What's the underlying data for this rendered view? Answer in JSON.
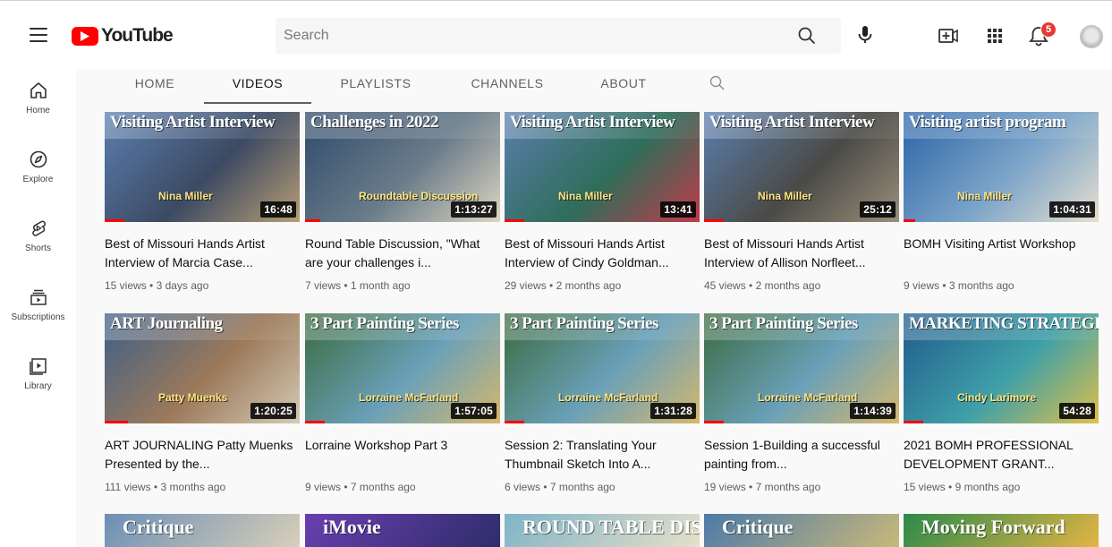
{
  "app": {
    "logo_text": "YouTube",
    "search_placeholder": "Search",
    "notification_count": "5"
  },
  "sidebar": {
    "items": [
      {
        "label": "Home",
        "icon": "home-icon"
      },
      {
        "label": "Explore",
        "icon": "compass-icon"
      },
      {
        "label": "Shorts",
        "icon": "shorts-icon"
      },
      {
        "label": "Subscriptions",
        "icon": "subscriptions-icon"
      },
      {
        "label": "Library",
        "icon": "library-icon"
      }
    ]
  },
  "tabs": [
    {
      "label": "HOME",
      "active": false
    },
    {
      "label": "VIDEOS",
      "active": true
    },
    {
      "label": "PLAYLISTS",
      "active": false
    },
    {
      "label": "CHANNELS",
      "active": false
    },
    {
      "label": "ABOUT",
      "active": false
    }
  ],
  "videos": [
    {
      "title": "Best of Missouri Hands Artist Interview of Marcia Case...",
      "views": "15 views",
      "age": "3 days ago",
      "duration": "16:48",
      "thumb_text": "Visiting Artist Interview",
      "thumb_sub": "Nina Miller",
      "progress": 0.1,
      "colors": [
        "#5b7fb0",
        "#3c4a63",
        "#b89e74"
      ]
    },
    {
      "title": "Round Table Discussion, \"What are your challenges i...",
      "views": "7 views",
      "age": "1 month ago",
      "duration": "1:13:27",
      "thumb_text": "Challenges in 2022",
      "thumb_sub": "Roundtable Discussion",
      "progress": 0.08,
      "colors": [
        "#2f4a6a",
        "#6a7c8a",
        "#dcd6c0"
      ]
    },
    {
      "title": "Best of Missouri Hands Artist Interview of Cindy Goldman...",
      "views": "29 views",
      "age": "2 months ago",
      "duration": "13:41",
      "thumb_text": "Visiting Artist Interview",
      "thumb_sub": "Nina Miller",
      "progress": 0.1,
      "colors": [
        "#5b7fb0",
        "#2f6d5a",
        "#c03a4a"
      ]
    },
    {
      "title": "Best of Missouri Hands Artist Interview of Allison Norfleet...",
      "views": "45 views",
      "age": "2 months ago",
      "duration": "25:12",
      "thumb_text": "Visiting Artist Interview",
      "thumb_sub": "Nina Miller",
      "progress": 0.1,
      "colors": [
        "#5b7fb0",
        "#4a4a46",
        "#9a8f7b"
      ]
    },
    {
      "title": "BOMH Visiting Artist Workshop",
      "views": "9 views",
      "age": "3 months ago",
      "duration": "1:04:31",
      "thumb_text": "Visiting artist program",
      "thumb_sub": "Nina Miller",
      "progress": 0.06,
      "colors": [
        "#2b63a8",
        "#7ba4c8",
        "#e7dfcf"
      ]
    },
    {
      "title": "ART JOURNALING Patty Muenks Presented by the...",
      "views": "111 views",
      "age": "3 months ago",
      "duration": "1:20:25",
      "thumb_text": "ART Journaling",
      "thumb_sub": "Patty Muenks",
      "progress": 0.12,
      "colors": [
        "#3d5f88",
        "#9c7a5a",
        "#d5cbb7"
      ]
    },
    {
      "title": "Lorraine Workshop Part 3",
      "views": "9 views",
      "age": "7 months ago",
      "duration": "1:57:05",
      "thumb_text": "3 Part Painting Series",
      "thumb_sub": "Lorraine McFarland",
      "progress": 0.1,
      "colors": [
        "#3a6b3f",
        "#6aa0b8",
        "#d6b86d"
      ]
    },
    {
      "title": "Session 2: Translating Your Thumbnail Sketch Into A...",
      "views": "6 views",
      "age": "7 months ago",
      "duration": "1:31:28",
      "thumb_text": "3 Part Painting Series",
      "thumb_sub": "Lorraine McFarland",
      "progress": 0.1,
      "colors": [
        "#3a6b3f",
        "#6aa0b8",
        "#d6b86d"
      ]
    },
    {
      "title": "Session 1-Building a successful painting from...",
      "views": "19 views",
      "age": "7 months ago",
      "duration": "1:14:39",
      "thumb_text": "3 Part Painting Series",
      "thumb_sub": "Lorraine McFarland",
      "progress": 0.1,
      "colors": [
        "#3a6b3f",
        "#6aa0b8",
        "#d6b86d"
      ]
    },
    {
      "title": "2021 BOMH PROFESSIONAL DEVELOPMENT GRANT...",
      "views": "15 views",
      "age": "9 months ago",
      "duration": "54:28",
      "thumb_text": "MARKETING STRATEGIES FOR ARTISTS",
      "thumb_sub": "Cindy Larimore",
      "progress": 0.1,
      "colors": [
        "#1f5a8c",
        "#3fa0a8",
        "#e0c04a"
      ]
    }
  ],
  "partial_row": [
    {
      "text": "Critique",
      "colors": [
        "#6c8fb5",
        "#d8cfb8"
      ]
    },
    {
      "text": "iMovie",
      "colors": [
        "#6a3fb0",
        "#2d2d6a"
      ]
    },
    {
      "text": "ROUND TABLE DISCUSSION",
      "colors": [
        "#7fb3c8",
        "#e6e0c8"
      ]
    },
    {
      "text": "Critique",
      "colors": [
        "#4c7aa8",
        "#c8b87a"
      ]
    },
    {
      "text": "Moving Forward",
      "colors": [
        "#2b8a4a",
        "#e3b444"
      ]
    }
  ],
  "colors": {
    "brand": "#ff0000",
    "badge": "#e53935"
  }
}
